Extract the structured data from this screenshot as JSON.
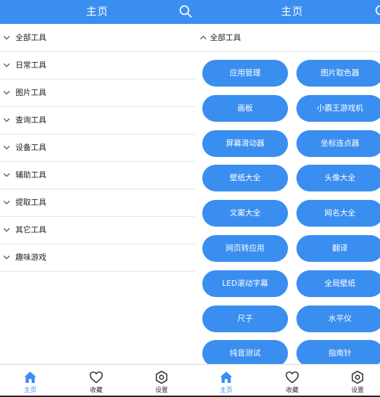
{
  "colors": {
    "accent": "#3a8ef0",
    "text": "#222222",
    "divider": "#e4e4e4"
  },
  "left": {
    "header": {
      "title": "主页",
      "search_icon": "search-icon"
    },
    "categories": [
      {
        "label": "全部工具",
        "expanded": false
      },
      {
        "label": "日常工具",
        "expanded": false
      },
      {
        "label": "图片工具",
        "expanded": false
      },
      {
        "label": "查询工具",
        "expanded": false
      },
      {
        "label": "设备工具",
        "expanded": false
      },
      {
        "label": "辅助工具",
        "expanded": false
      },
      {
        "label": "提取工具",
        "expanded": false
      },
      {
        "label": "其它工具",
        "expanded": false
      },
      {
        "label": "趣味游戏",
        "expanded": false
      }
    ],
    "nav": [
      {
        "label": "主页",
        "icon": "home-icon",
        "active": true
      },
      {
        "label": "收藏",
        "icon": "heart-icon",
        "active": false
      },
      {
        "label": "设置",
        "icon": "settings-icon",
        "active": false
      }
    ]
  },
  "right": {
    "header": {
      "title": "主页",
      "search_icon": "search-icon"
    },
    "section": {
      "label": "全部工具",
      "expanded": true
    },
    "tools": [
      [
        "应用管理",
        "图片取色器"
      ],
      [
        "画板",
        "小霸王游戏机"
      ],
      [
        "屏幕滑动器",
        "坐标连点器"
      ],
      [
        "壁纸大全",
        "头像大全"
      ],
      [
        "文案大全",
        "网名大全"
      ],
      [
        "网页转应用",
        "翻译"
      ],
      [
        "LED滚动字幕",
        "全局壁纸"
      ],
      [
        "尺子",
        "水平仪"
      ],
      [
        "纯音测试",
        "指南针"
      ]
    ],
    "nav": [
      {
        "label": "主页",
        "icon": "home-icon",
        "active": true
      },
      {
        "label": "收藏",
        "icon": "heart-icon",
        "active": false
      },
      {
        "label": "设置",
        "icon": "settings-icon",
        "active": false
      }
    ]
  }
}
